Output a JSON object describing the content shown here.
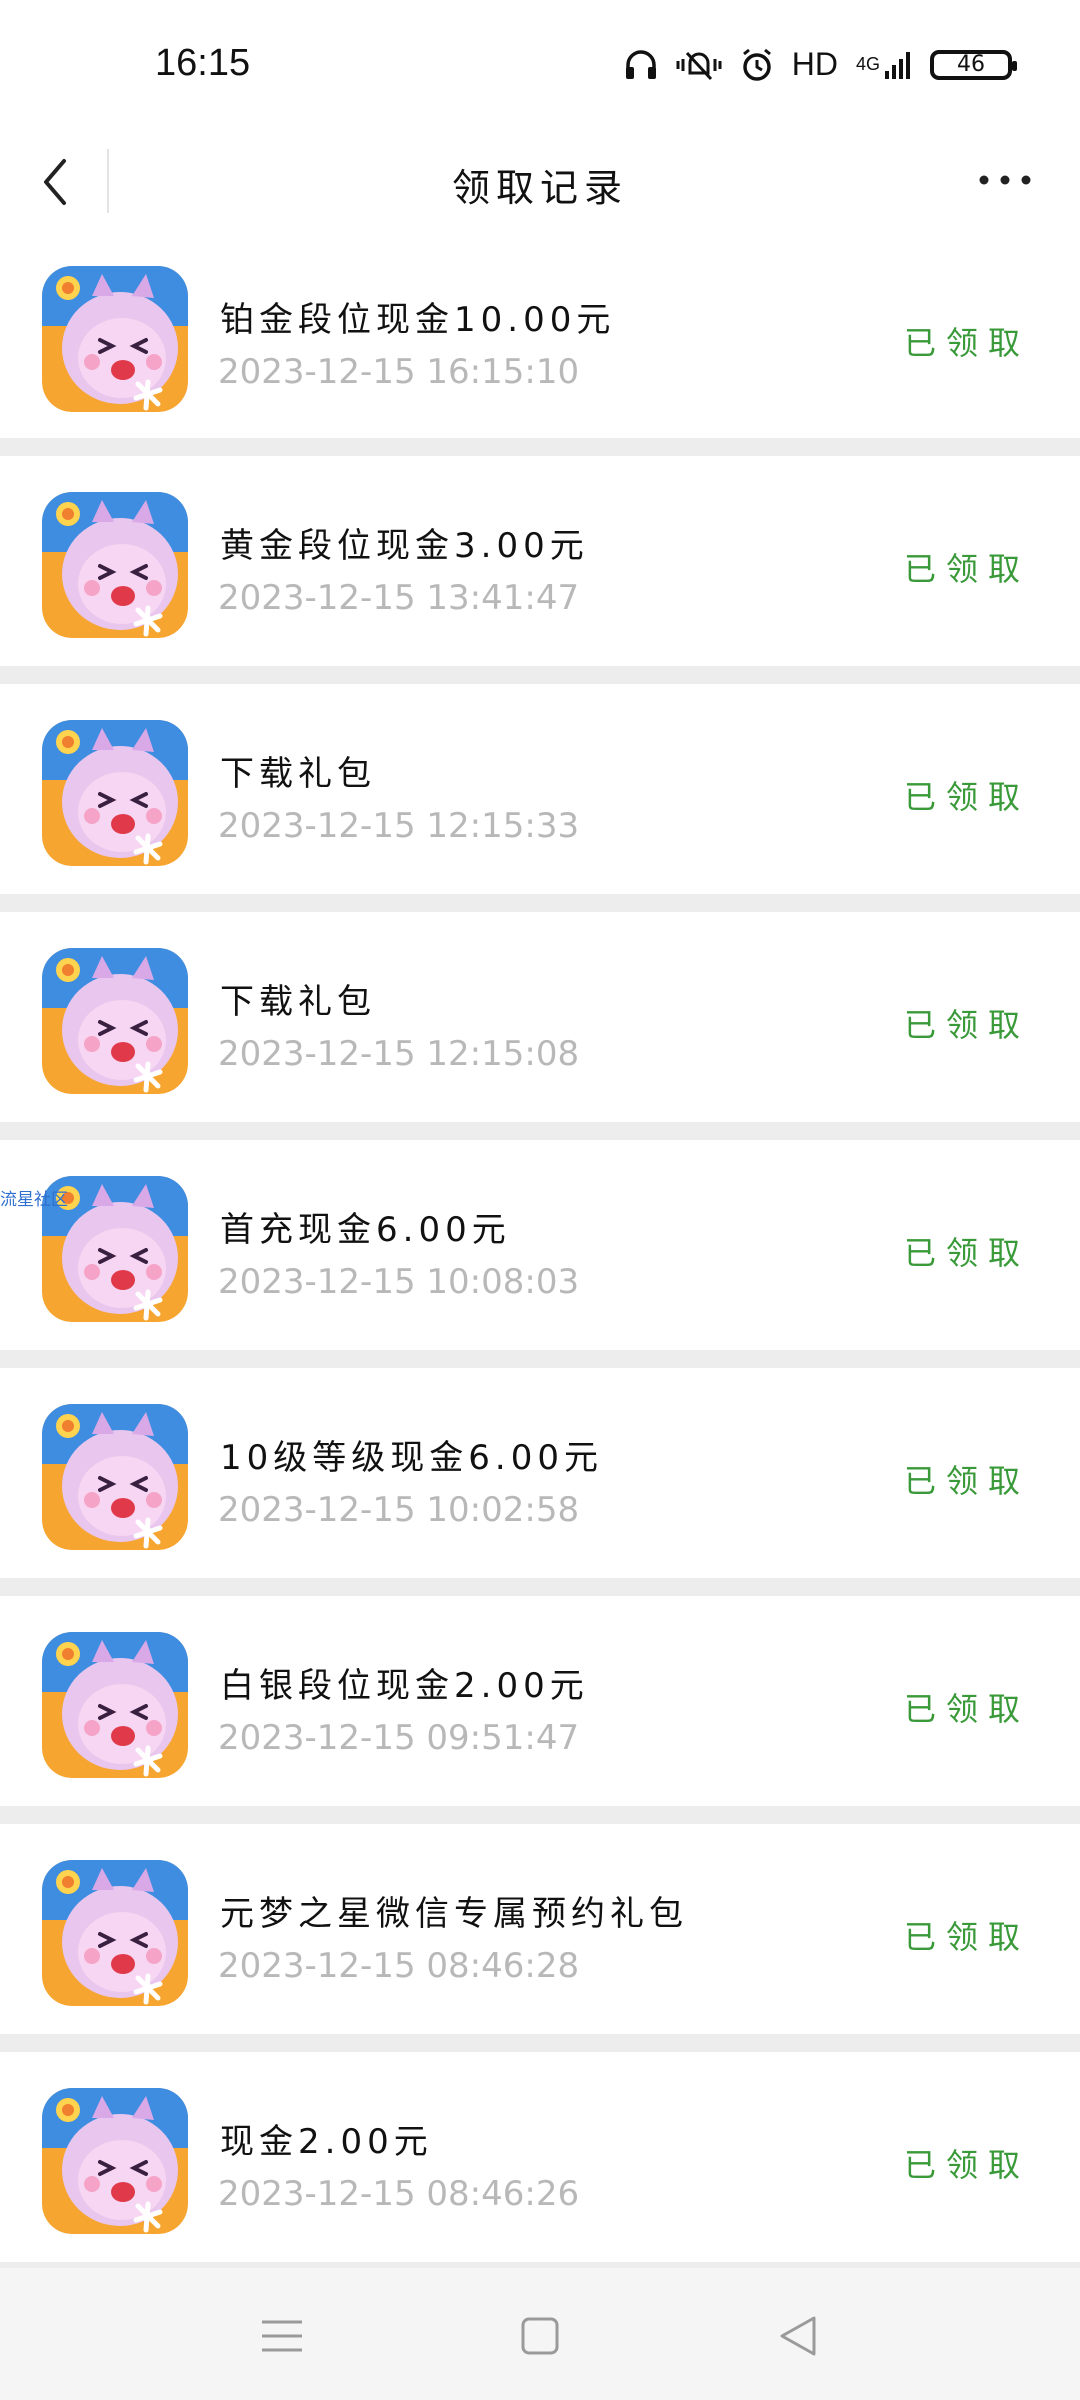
{
  "status_bar": {
    "time": "16:15",
    "network": "HD",
    "signal": "4G",
    "battery": "46"
  },
  "header": {
    "title": "领取记录"
  },
  "records": [
    {
      "title": "铂金段位现金10.00元",
      "time": "2023-12-15 16:15:10",
      "status": "已领取"
    },
    {
      "title": "黄金段位现金3.00元",
      "time": "2023-12-15 13:41:47",
      "status": "已领取"
    },
    {
      "title": "下载礼包",
      "time": "2023-12-15 12:15:33",
      "status": "已领取"
    },
    {
      "title": "下载礼包",
      "time": "2023-12-15 12:15:08",
      "status": "已领取"
    },
    {
      "title": "首充现金6.00元",
      "time": "2023-12-15 10:08:03",
      "status": "已领取"
    },
    {
      "title": "10级等级现金6.00元",
      "time": "2023-12-15 10:02:58",
      "status": "已领取"
    },
    {
      "title": "白银段位现金2.00元",
      "time": "2023-12-15 09:51:47",
      "status": "已领取"
    },
    {
      "title": "元梦之星微信专属预约礼包",
      "time": "2023-12-15 08:46:28",
      "status": "已领取"
    },
    {
      "title": "现金2.00元",
      "time": "2023-12-15 08:46:26",
      "status": "已领取"
    }
  ],
  "watermark": "流星社区",
  "colors": {
    "status_green": "#3a9a3a",
    "time_gray": "#b8b8b8",
    "background": "#ededed"
  },
  "icons": [
    "back-arrow-icon",
    "more-icon",
    "app-icon",
    "menu-icon",
    "home-icon",
    "back-icon"
  ]
}
